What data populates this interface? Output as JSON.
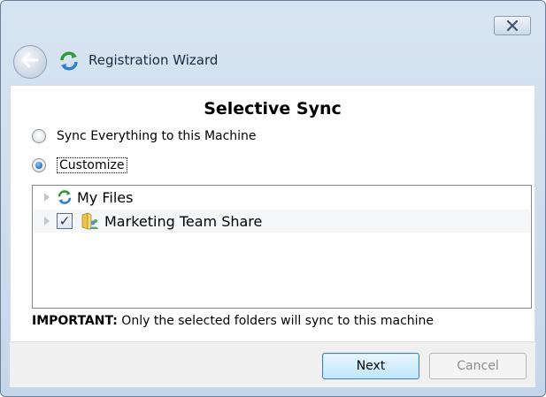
{
  "window": {
    "title": "Registration Wizard",
    "close_icon": "close-icon",
    "back_icon": "back-arrow-icon",
    "app_icon": "sync-icon"
  },
  "main": {
    "heading": "Selective Sync",
    "options": [
      {
        "label": "Sync Everything to this Machine",
        "selected": false
      },
      {
        "label": "Customize",
        "selected": true
      }
    ],
    "tree": [
      {
        "label": "My Files",
        "icon": "sync-icon",
        "checkbox": false,
        "checked": false
      },
      {
        "label": "Marketing Team Share",
        "icon": "shared-folder-icon",
        "checkbox": true,
        "checked": true
      }
    ],
    "important_label": "IMPORTANT:",
    "important_text": " Only the selected folders will sync to this machine"
  },
  "footer": {
    "next_label": "Next",
    "cancel_label": "Cancel",
    "cancel_enabled": false
  },
  "colors": {
    "accent": "#3c7fb1",
    "chrome": "#c6d6ea"
  }
}
